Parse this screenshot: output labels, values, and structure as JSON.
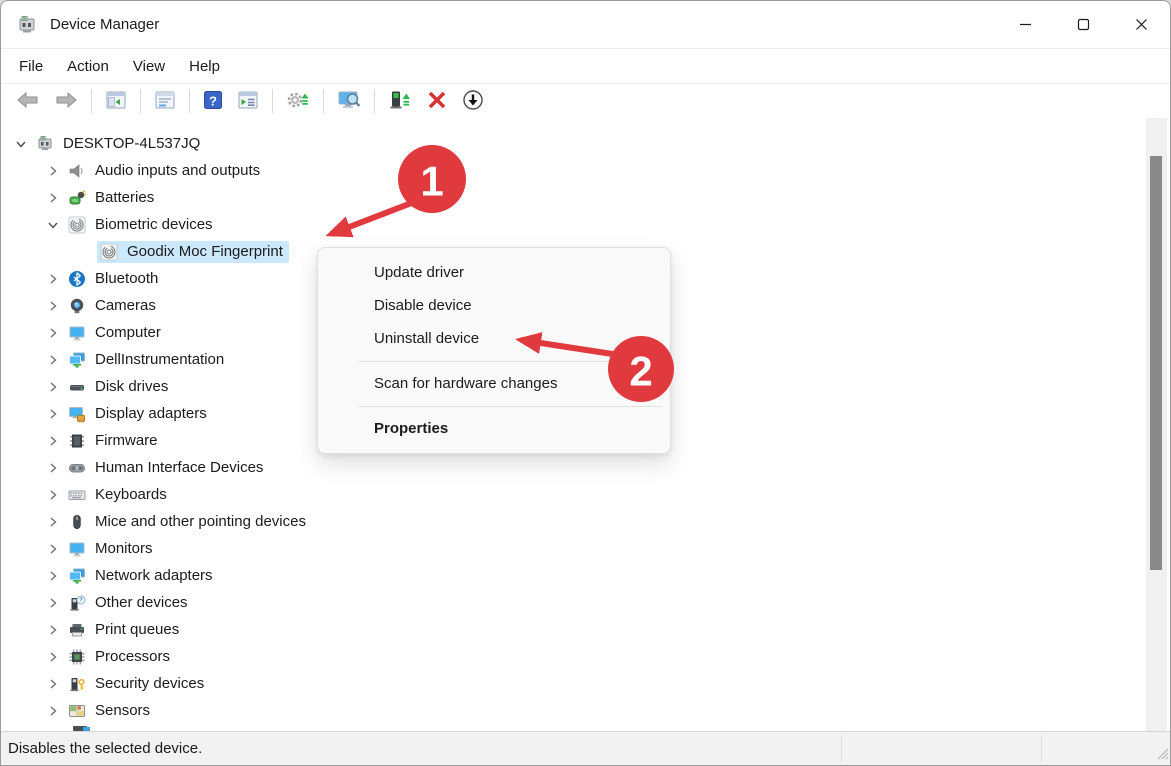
{
  "window": {
    "title": "Device Manager",
    "controls": [
      {
        "name": "minimize",
        "icon": "minimize-icon"
      },
      {
        "name": "maximize",
        "icon": "maximize-icon"
      },
      {
        "name": "close",
        "icon": "close-icon"
      }
    ]
  },
  "menu_bar": {
    "items": [
      "File",
      "Action",
      "View",
      "Help"
    ]
  },
  "toolbar": {
    "buttons": [
      {
        "name": "back",
        "icon": "back-arrow-icon"
      },
      {
        "name": "forward",
        "icon": "forward-arrow-icon"
      },
      {
        "type": "separator"
      },
      {
        "name": "show-console-tree",
        "icon": "console-tree-icon"
      },
      {
        "type": "separator"
      },
      {
        "name": "properties",
        "icon": "properties-window-icon"
      },
      {
        "type": "separator"
      },
      {
        "name": "help",
        "icon": "help-icon"
      },
      {
        "name": "show-action-pane",
        "icon": "action-pane-icon"
      },
      {
        "type": "separator"
      },
      {
        "name": "update-driver-software",
        "icon": "gear-up-arrow-icon"
      },
      {
        "type": "separator"
      },
      {
        "name": "scan-hardware-changes",
        "icon": "monitor-search-icon"
      },
      {
        "type": "separator"
      },
      {
        "name": "update-driver",
        "icon": "device-up-arrow-icon"
      },
      {
        "name": "uninstall-device",
        "icon": "red-x-icon"
      },
      {
        "name": "disable-device",
        "icon": "down-arrow-circle-icon"
      }
    ]
  },
  "tree": {
    "items": [
      {
        "label": "DESKTOP-4L537JQ",
        "level": 0,
        "state": "expanded",
        "icon": "computer-root"
      },
      {
        "label": "Audio inputs and outputs",
        "level": 1,
        "state": "collapsed",
        "icon": "audio"
      },
      {
        "label": "Batteries",
        "level": 1,
        "state": "collapsed",
        "icon": "battery"
      },
      {
        "label": "Biometric devices",
        "level": 1,
        "state": "expanded",
        "icon": "fingerprint"
      },
      {
        "label": "Goodix Moc Fingerprint",
        "level": 2,
        "state": "none",
        "icon": "fingerprint",
        "selected": true
      },
      {
        "label": "Bluetooth",
        "level": 1,
        "state": "collapsed",
        "icon": "bluetooth"
      },
      {
        "label": "Cameras",
        "level": 1,
        "state": "collapsed",
        "icon": "camera"
      },
      {
        "label": "Computer",
        "level": 1,
        "state": "collapsed",
        "icon": "monitor"
      },
      {
        "label": "DellInstrumentation",
        "level": 1,
        "state": "collapsed",
        "icon": "dual-monitor"
      },
      {
        "label": "Disk drives",
        "level": 1,
        "state": "collapsed",
        "icon": "disk"
      },
      {
        "label": "Display adapters",
        "level": 1,
        "state": "collapsed",
        "icon": "display-adapter"
      },
      {
        "label": "Firmware",
        "level": 1,
        "state": "collapsed",
        "icon": "chip"
      },
      {
        "label": "Human Interface Devices",
        "level": 1,
        "state": "collapsed",
        "icon": "gamepad"
      },
      {
        "label": "Keyboards",
        "level": 1,
        "state": "collapsed",
        "icon": "keyboard"
      },
      {
        "label": "Mice and other pointing devices",
        "level": 1,
        "state": "collapsed",
        "icon": "mouse"
      },
      {
        "label": "Monitors",
        "level": 1,
        "state": "collapsed",
        "icon": "monitor"
      },
      {
        "label": "Network adapters",
        "level": 1,
        "state": "collapsed",
        "icon": "dual-monitor"
      },
      {
        "label": "Other devices",
        "level": 1,
        "state": "collapsed",
        "icon": "unknown-device"
      },
      {
        "label": "Print queues",
        "level": 1,
        "state": "collapsed",
        "icon": "printer"
      },
      {
        "label": "Processors",
        "level": 1,
        "state": "collapsed",
        "icon": "processor"
      },
      {
        "label": "Security devices",
        "level": 1,
        "state": "collapsed",
        "icon": "security"
      },
      {
        "label": "Sensors",
        "level": 1,
        "state": "collapsed",
        "icon": "sensors"
      }
    ]
  },
  "context_menu": {
    "items": [
      {
        "label": "Update driver"
      },
      {
        "label": "Disable device"
      },
      {
        "label": "Uninstall device"
      },
      {
        "type": "separator"
      },
      {
        "label": "Scan for hardware changes"
      },
      {
        "type": "separator"
      },
      {
        "label": "Properties",
        "bold": true
      }
    ]
  },
  "annotations": [
    {
      "label": "1"
    },
    {
      "label": "2"
    }
  ],
  "status_bar": {
    "text": "Disables the selected device."
  },
  "colors": {
    "selection_highlight": "#cce8ff",
    "annotation_red": "#e03a3e",
    "scrollbar_thumb": "#8a8a8a"
  }
}
